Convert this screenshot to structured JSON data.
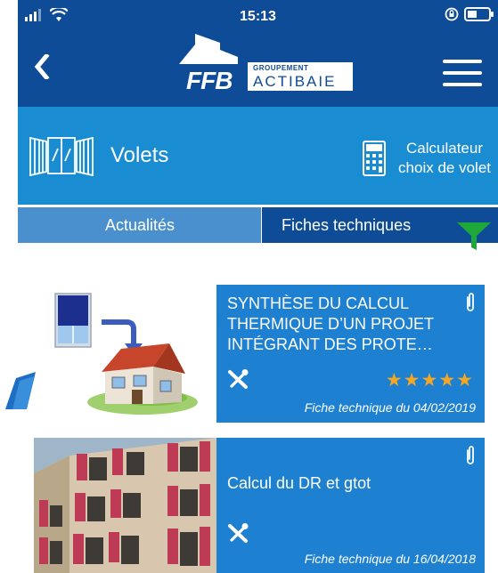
{
  "status_bar": {
    "time": "15:13"
  },
  "header": {
    "logo_ffb": "FFB",
    "logo_groupement": "GROUPEMENT",
    "logo_actibaie": "ACTIBAIE"
  },
  "categories": {
    "volets_label": "Volets",
    "calculator_line1": "Calculateur",
    "calculator_line2": "choix de volet"
  },
  "tabs": [
    {
      "label": "Actualités",
      "selected": false
    },
    {
      "label": "Fiches techniques",
      "selected": true
    }
  ],
  "cards": [
    {
      "title": "SYNTHÈSE DU CALCUL THERMIQUE D’UN PROJET INTÉGRANT DES PROTE…",
      "stars": "★★★★★",
      "rating": 5,
      "date": "Fiche technique du 04/02/2019"
    },
    {
      "title": "Calcul du DR et gtot",
      "date": "Fiche technique du 16/04/2018"
    }
  ],
  "colors": {
    "header": "#0f4c97",
    "band": "#1a8dd2",
    "card": "#1e80d0",
    "tab_inactive": "#4a90cf",
    "filter": "#1fa83a",
    "stars": "#f5a623"
  },
  "icons": {
    "signal": "signal-bars-icon",
    "wifi": "wifi-icon",
    "lock": "orientation-lock-icon",
    "battery": "battery-icon",
    "back": "chevron-left-icon",
    "menu": "hamburger-menu-icon",
    "volets": "window-shutter-icon",
    "calculator": "calculator-icon",
    "filter": "filter-funnel-icon",
    "attachment": "paperclip-icon",
    "tools": "tools-icon"
  }
}
